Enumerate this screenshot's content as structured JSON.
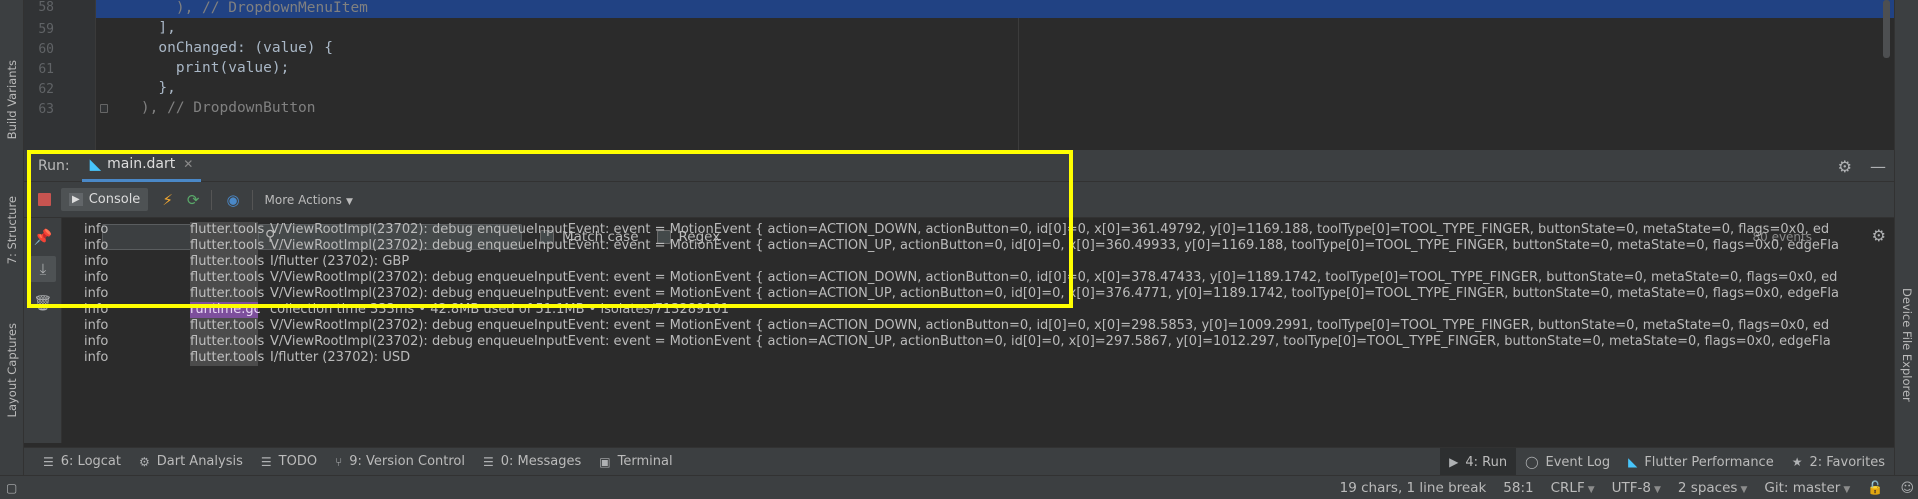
{
  "left_strip": {
    "build_variants": "Build Variants",
    "structure": "7: Structure",
    "layout_captures": "Layout Captures"
  },
  "right_strip": {
    "device_file_explorer": "Device File Explorer"
  },
  "editor": {
    "lines": [
      {
        "num": "58",
        "indent": "        ",
        "code": "), // DropdownMenuItem",
        "highlight": true
      },
      {
        "num": "59",
        "indent": "      ",
        "code": "],",
        "highlight": false
      },
      {
        "num": "60",
        "indent": "      ",
        "code": "onChanged: (value) {",
        "highlight": false
      },
      {
        "num": "61",
        "indent": "        ",
        "code": "print(value);",
        "highlight": false
      },
      {
        "num": "62",
        "indent": "      ",
        "code": "},",
        "highlight": false
      },
      {
        "num": "63",
        "indent": "    ",
        "code": "), // DropdownButton",
        "highlight": false
      }
    ]
  },
  "run_panel": {
    "label": "Run:",
    "tab_name": "main.dart",
    "console_label": "Console",
    "more_actions": "More Actions",
    "match_case": "Match case",
    "regex": "Regex",
    "events": "80 events",
    "log": [
      {
        "level": "info",
        "tag": "flutter.tools",
        "msg": "V/ViewRootImpl(23702): debug enqueueInputEvent: event = MotionEvent { action=ACTION_DOWN, actionButton=0, id[0]=0, x[0]=361.49792, y[0]=1169.188, toolType[0]=TOOL_TYPE_FINGER, buttonState=0, metaState=0, flags=0x0, ed"
      },
      {
        "level": "info",
        "tag": "flutter.tools",
        "msg": "V/ViewRootImpl(23702): debug enqueueInputEvent: event = MotionEvent { action=ACTION_UP, actionButton=0, id[0]=0, x[0]=360.49933, y[0]=1169.188, toolType[0]=TOOL_TYPE_FINGER, buttonState=0, metaState=0, flags=0x0, edgeFla"
      },
      {
        "level": "info",
        "tag": "flutter.tools",
        "msg": "I/flutter (23702): GBP"
      },
      {
        "level": "info",
        "tag": "flutter.tools",
        "msg": "V/ViewRootImpl(23702): debug enqueueInputEvent: event = MotionEvent { action=ACTION_DOWN, actionButton=0, id[0]=0, x[0]=378.47433, y[0]=1189.1742, toolType[0]=TOOL_TYPE_FINGER, buttonState=0, metaState=0, flags=0x0, ed"
      },
      {
        "level": "info",
        "tag": "flutter.tools",
        "msg": "V/ViewRootImpl(23702): debug enqueueInputEvent: event = MotionEvent { action=ACTION_UP, actionButton=0, id[0]=0, x[0]=376.4771, y[0]=1189.1742, toolType[0]=TOOL_TYPE_FINGER, buttonState=0, metaState=0, flags=0x0, edgeFla"
      },
      {
        "level": "info",
        "tag": "runtime.gc",
        "msg": "collection time 333ms • 42.8MB used of 51.1MB • isolates/713289101"
      },
      {
        "level": "info",
        "tag": "flutter.tools",
        "msg": "V/ViewRootImpl(23702): debug enqueueInputEvent: event = MotionEvent { action=ACTION_DOWN, actionButton=0, id[0]=0, x[0]=298.5853, y[0]=1009.2991, toolType[0]=TOOL_TYPE_FINGER, buttonState=0, metaState=0, flags=0x0, ed"
      },
      {
        "level": "info",
        "tag": "flutter.tools",
        "msg": "V/ViewRootImpl(23702): debug enqueueInputEvent: event = MotionEvent { action=ACTION_UP, actionButton=0, id[0]=0, x[0]=297.5867, y[0]=1012.297, toolType[0]=TOOL_TYPE_FINGER, buttonState=0, metaState=0, flags=0x0, edgeFla"
      },
      {
        "level": "info",
        "tag": "flutter.tools",
        "msg": "I/flutter (23702): USD"
      }
    ]
  },
  "tool_windows": {
    "logcat": "6: Logcat",
    "dart_analysis": "Dart Analysis",
    "todo": "TODO",
    "version_control": "9: Version Control",
    "messages": "0: Messages",
    "terminal": "Terminal",
    "run": "4: Run",
    "event_log": "Event Log",
    "flutter_performance": "Flutter Performance",
    "favorites": "2: Favorites"
  },
  "status": {
    "selection": "19 chars, 1 line break",
    "position": "58:1",
    "line_sep": "CRLF",
    "encoding": "UTF-8",
    "indent": "2 spaces",
    "git": "Git: master"
  }
}
